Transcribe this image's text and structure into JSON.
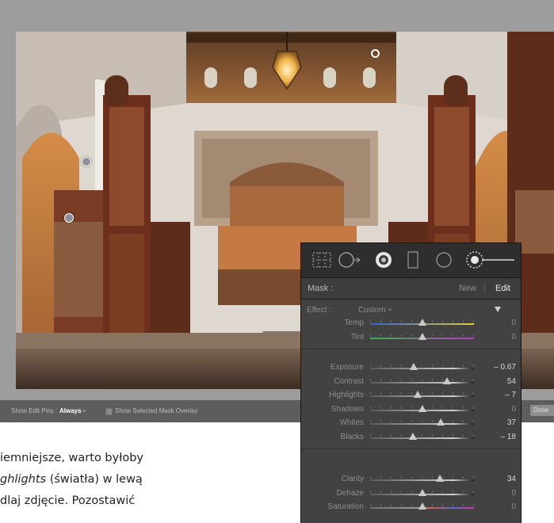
{
  "statusbar": {
    "show_edit_pins_label": "Show Edit Pins :",
    "show_edit_pins_value": "Always",
    "show_edit_pins_arrow": "÷",
    "show_mask_overlay_label": "Show Selected Mask Overlay",
    "done_label": "Done"
  },
  "panel": {
    "mask_label": "Mask :",
    "new_label": "New",
    "edit_label": "Edit",
    "effect_label": "Effect :",
    "effect_value": "Custom ÷",
    "temp_tint": [
      {
        "name": "Temp",
        "value": "0",
        "pos": 0.5,
        "track": "temp"
      },
      {
        "name": "Tint",
        "value": "0",
        "pos": 0.5,
        "track": "tint"
      }
    ],
    "tone": [
      {
        "name": "Exposure",
        "value": "– 0.67",
        "pos": 0.42,
        "track": "plain",
        "bright": true
      },
      {
        "name": "Contrast",
        "value": "54",
        "pos": 0.74,
        "track": "plain",
        "bright": true
      },
      {
        "name": "Highlights",
        "value": "– 7",
        "pos": 0.46,
        "track": "plain",
        "bright": true
      },
      {
        "name": "Shadows",
        "value": "0",
        "pos": 0.5,
        "track": "plain",
        "bright": false
      },
      {
        "name": "Whites",
        "value": "37",
        "pos": 0.68,
        "track": "plain",
        "bright": true
      },
      {
        "name": "Blacks",
        "value": "– 18",
        "pos": 0.41,
        "track": "plain",
        "bright": true
      }
    ],
    "presence": [
      {
        "name": "Clarity",
        "value": "34",
        "pos": 0.67,
        "track": "plain",
        "bright": true
      },
      {
        "name": "Dehaze",
        "value": "0",
        "pos": 0.5,
        "track": "plain",
        "bright": false
      },
      {
        "name": "Saturation",
        "value": "0",
        "pos": 0.5,
        "track": "sat",
        "bright": false
      }
    ]
  },
  "caption": {
    "line1": "iemniejsze, warto byłoby",
    "line2_italic": "ghlights",
    "line2_rest": " (światła) w lewą",
    "line3": "dlaj zdjęcie. Pozostawić"
  },
  "colors": {
    "temp_left": "#3d5fd0",
    "temp_right": "#d9cc45",
    "tint_left": "#3bb04a",
    "tint_right": "#b53bc3",
    "photo_wall": "#e8e4df"
  }
}
